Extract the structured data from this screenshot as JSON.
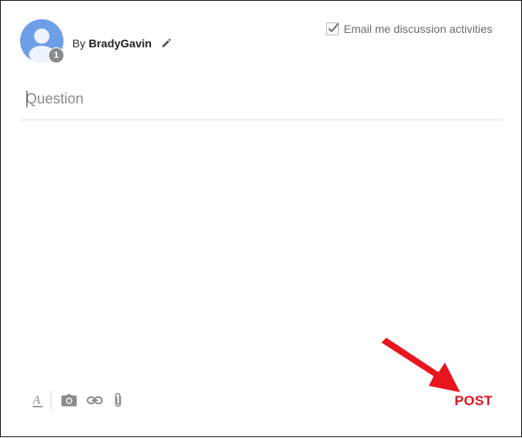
{
  "author": {
    "prefix": "By",
    "name": "BradyGavin",
    "badge_count": "1",
    "avatar_color": "#6f9ee8"
  },
  "email_option": {
    "label": "Email me discussion activities",
    "checked": true
  },
  "question": {
    "placeholder": "Question",
    "value": ""
  },
  "toolbar": {
    "icons": [
      "text-format-icon",
      "camera-icon",
      "link-icon",
      "attachment-icon"
    ]
  },
  "post_button": {
    "label": "POST",
    "color": "#e0141e"
  },
  "annotation": {
    "arrow_color": "#e8141e"
  }
}
